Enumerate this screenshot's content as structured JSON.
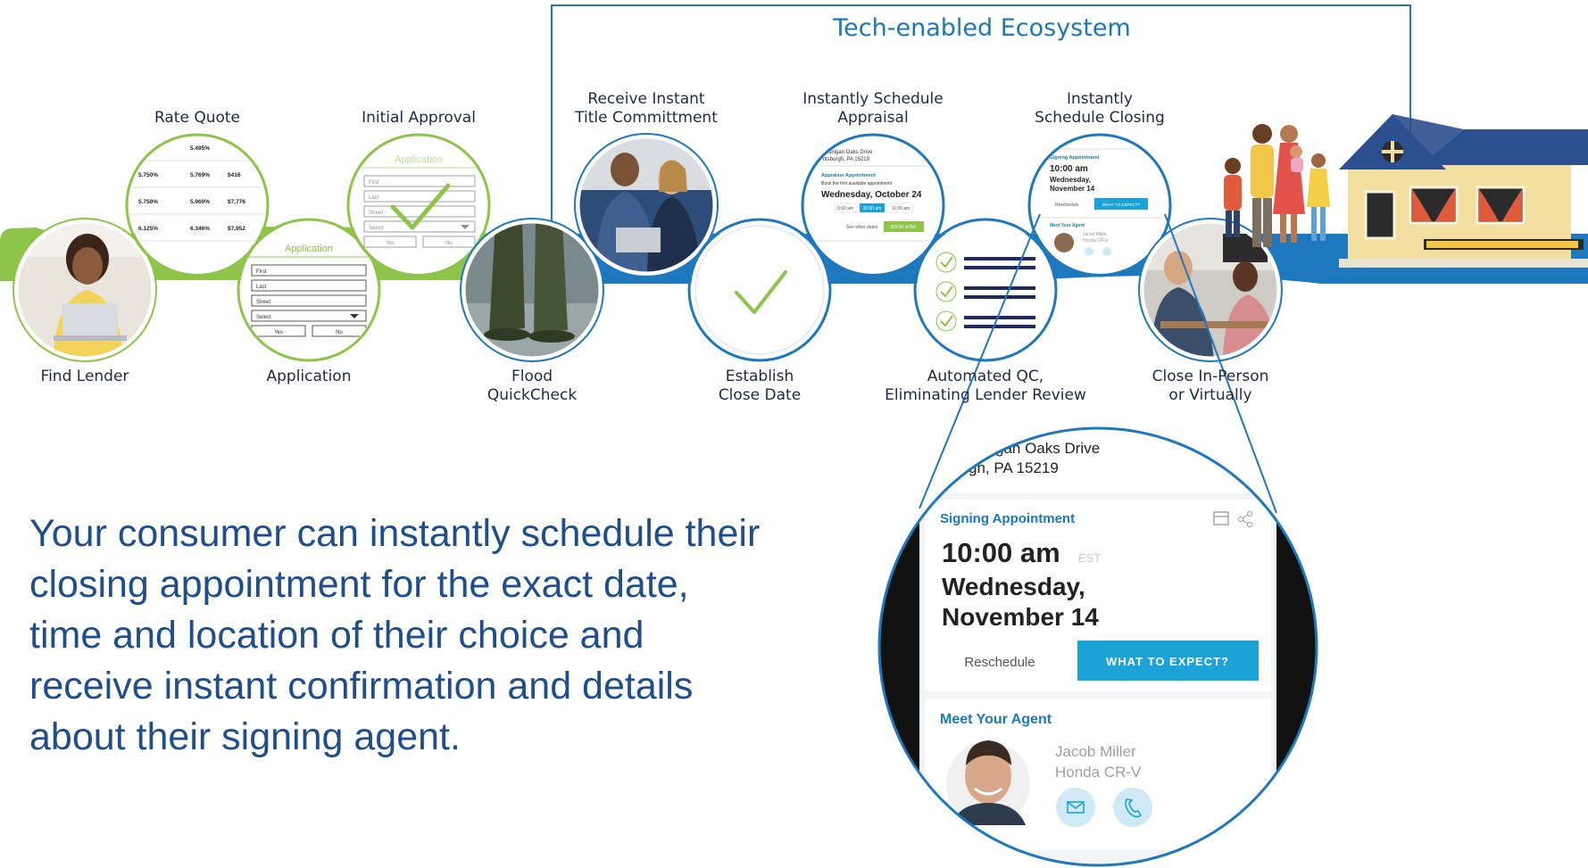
{
  "ecosystem_title": "Tech-enabled Ecosystem",
  "stages": [
    {
      "id": "find-lender",
      "label": "Find Lender"
    },
    {
      "id": "rate-quote",
      "label": "Rate Quote"
    },
    {
      "id": "application",
      "label": "Application"
    },
    {
      "id": "initial-approval",
      "label": "Initial Approval"
    },
    {
      "id": "flood-quickcheck",
      "label": "Flood\nQuickCheck"
    },
    {
      "id": "title-commitment",
      "label": "Receive Instant\nTitle Committment"
    },
    {
      "id": "establish-close-date",
      "label": "Establish\nClose Date"
    },
    {
      "id": "schedule-appraisal",
      "label": "Instantly Schedule\nAppraisal"
    },
    {
      "id": "automated-qc",
      "label": "Automated QC,\nEliminating Lender Review"
    },
    {
      "id": "schedule-closing",
      "label": "Instantly\nSchedule Closing"
    },
    {
      "id": "close-in-person",
      "label": "Close In-Person\nor Virtually"
    }
  ],
  "rate_quote": {
    "rows": [
      {
        "a": "",
        "b": "5.495%",
        "c": ""
      },
      {
        "a": "5.750%",
        "b": "5.769%",
        "c": "$416"
      },
      {
        "a": "5.750%",
        "b": "5.960%",
        "c": "$7,776"
      },
      {
        "a": "6.125%",
        "b": "6.346%",
        "c": "$7,952"
      }
    ]
  },
  "application_form": {
    "title": "Application",
    "fields": [
      "First",
      "Last",
      "Street"
    ],
    "select": "Select",
    "yes": "Yes",
    "no": "No"
  },
  "appraisal_thumb": {
    "address1": "5 Flanigan Oaks Drive",
    "address2": "Pittsburgh, PA 15219",
    "heading": "Appraiser Appointment",
    "sub": "Book the first available appointment",
    "date": "Wednesday, October 24",
    "time1": "9:00 am",
    "time2": "10:00 am",
    "time3": "11:00 am",
    "other": "See other dates",
    "book": "BOOK NOW"
  },
  "closing_thumb": {
    "heading": "Signing Appointment",
    "time": "10:00 am",
    "date": "Wednesday,\nNovember 14",
    "reschedule": "Reschedule",
    "expect": "WHAT TO EXPECT?",
    "agent_heading": "Meet Your Agent",
    "agent_name": "Jacob Miller",
    "agent_car": "Honda CR-V"
  },
  "zoom": {
    "address1": "gan Oaks Drive",
    "address2": "gh, PA 15219",
    "heading": "Signing Appointment",
    "time": "10:00 am",
    "tz": "EST",
    "date_line1": "Wednesday,",
    "date_line2": "November 14",
    "reschedule": "Reschedule",
    "expect": "WHAT TO EXPECT?",
    "agent_heading": "Meet Your Agent",
    "agent_name": "Jacob Miller",
    "agent_car": "Honda CR-V"
  },
  "body_text": "Your consumer can instantly schedule their closing appointment for the exact date, time and location of their choice and receive instant confirmation and details about their signing agent.",
  "colors": {
    "green": "#8dc449",
    "blue": "#1e78bd",
    "text_blue": "#1f4e8c",
    "accent": "#1a79b8",
    "cta": "#1ba3d8"
  }
}
